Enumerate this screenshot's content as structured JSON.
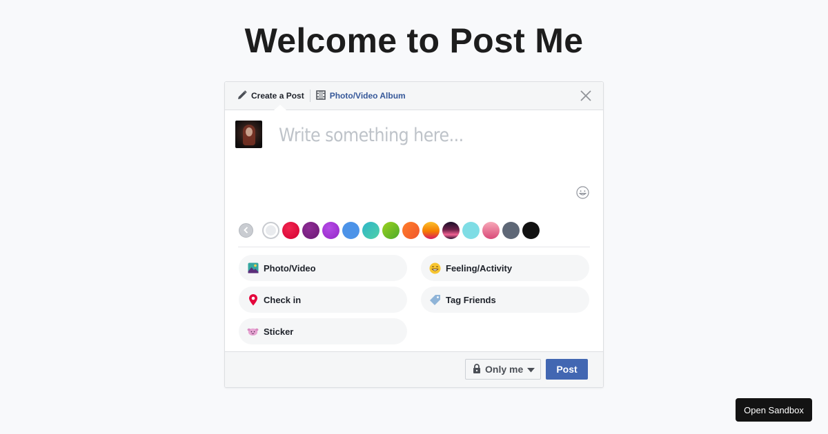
{
  "page": {
    "title": "Welcome to Post Me"
  },
  "composer": {
    "tabs": {
      "create_label": "Create a Post",
      "album_label": "Photo/Video Album"
    },
    "input": {
      "placeholder": "Write something here...",
      "value": ""
    },
    "background_colors": [
      {
        "name": "none",
        "color": "#ffffff",
        "selected": true
      },
      {
        "name": "red",
        "color": "#e4063c"
      },
      {
        "name": "dark-purple",
        "color": "#7b2181"
      },
      {
        "name": "violet",
        "color": "#a23ad1"
      },
      {
        "name": "blue",
        "color": "#4c93e8"
      },
      {
        "name": "teal",
        "color": "#3cc2b7"
      },
      {
        "name": "green",
        "color": "#71c21f"
      },
      {
        "name": "orange",
        "color": "#fb6d2c"
      },
      {
        "name": "sunset",
        "color": "#f5a623"
      },
      {
        "name": "night",
        "color": "#2f1731"
      },
      {
        "name": "light-blue",
        "color": "#7fdde5"
      },
      {
        "name": "pink",
        "color": "#e8748f"
      },
      {
        "name": "slate",
        "color": "#5e6776"
      },
      {
        "name": "black",
        "color": "#111111"
      }
    ],
    "actions": {
      "photo_video": "Photo/Video",
      "feeling_activity": "Feeling/Activity",
      "check_in": "Check in",
      "tag_friends": "Tag Friends",
      "sticker": "Sticker"
    },
    "footer": {
      "privacy_label": "Only me",
      "post_label": "Post"
    }
  },
  "sandbox": {
    "label": "Open Sandbox"
  },
  "colors": {
    "accent": "#4267b2",
    "link": "#365899",
    "background": "#f8f9fb"
  }
}
